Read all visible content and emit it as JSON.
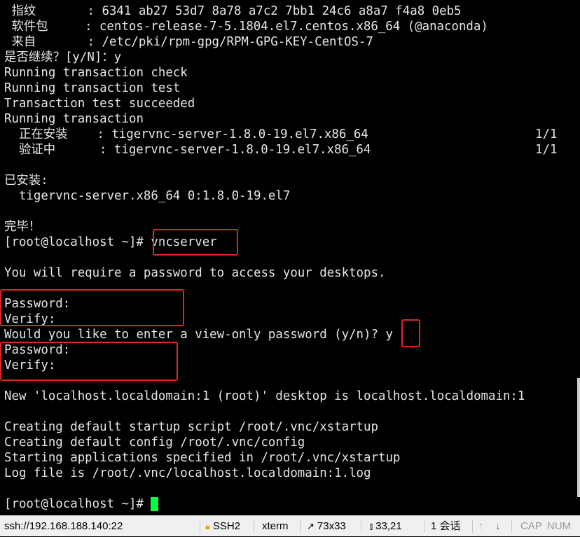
{
  "terminal": {
    "lines": [
      " 指纹       : 6341 ab27 53d7 8a78 a7c2 7bb1 24c6 a8a7 f4a8 0eb5",
      " 软件包     : centos-release-7-5.1804.el7.centos.x86_64 (@anaconda)",
      " 来自       : /etc/pki/rpm-gpg/RPM-GPG-KEY-CentOS-7",
      "是否继续？[y/N]：y",
      "Running transaction check",
      "Running transaction test",
      "Transaction test succeeded",
      "Running transaction",
      "  正在安装    : tigervnc-server-1.8.0-19.el7.x86_64",
      "  验证中      : tigervnc-server-1.8.0-19.el7.x86_64",
      "",
      "已安装:",
      "  tigervnc-server.x86_64 0:1.8.0-19.el7",
      "",
      "完毕！",
      "[root@localhost ~]# vncserver",
      "",
      "You will require a password to access your desktops.",
      "",
      "Password:",
      "Verify:",
      "Would you like to enter a view-only password (y/n)? y",
      "Password:",
      "Verify:",
      "",
      "New 'localhost.localdomain:1 (root)' desktop is localhost.localdomain:1",
      "",
      "Creating default startup script /root/.vnc/xstartup",
      "Creating default config /root/.vnc/config",
      "Starting applications specified in /root/.vnc/xstartup",
      "Log file is /root/.vnc/localhost.localdomain:1.log",
      "",
      "[root@localhost ~]# "
    ],
    "progress_installing": "1/1",
    "progress_verifying": "1/1",
    "cursor_color": "#00ff3c",
    "highlight_color": "#e0261e"
  },
  "statusbar": {
    "connection": "ssh://192.168.188.140:22",
    "protocol": "SSH2",
    "terminal_type": "xterm",
    "size": "73x33",
    "position": "33,21",
    "sessions": "1 会话",
    "caps": "CAP",
    "num": "NUM",
    "icons": [
      "lock-icon",
      "resize-icon",
      "cursor-position-icon",
      "arrow-up-icon",
      "arrow-down-icon"
    ]
  }
}
